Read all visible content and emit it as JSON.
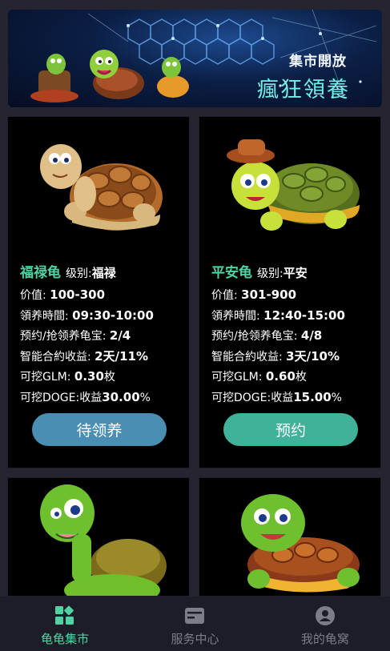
{
  "banner": {
    "line1": "集市開放",
    "line2": "瘋狂領養"
  },
  "cards": [
    {
      "name": "福禄龟",
      "level_label": "级别:",
      "level": "福禄",
      "price_label": "价值:",
      "price": "100-300",
      "time_label": "領养時間:",
      "time": "09:30-10:00",
      "reserve_label": "预约/抢领养龟宝:",
      "reserve": "2/4",
      "yield_label": "智能合約收益:",
      "yield": "2天/11%",
      "glm_label": "可挖GLM:",
      "glm": "0.30",
      "glm_unit": "枚",
      "doge_label": "可挖DOGE:收益",
      "doge": "30.00",
      "doge_unit": "%",
      "button": "待领养",
      "button_color": "#4a8fb3"
    },
    {
      "name": "平安龟",
      "level_label": "级别:",
      "level": "平安",
      "price_label": "价值:",
      "price": "301-900",
      "time_label": "領养時間:",
      "time": "12:40-15:00",
      "reserve_label": "预约/抢领养龟宝:",
      "reserve": "4/8",
      "yield_label": "智能合約收益:",
      "yield": "3天/10%",
      "glm_label": "可挖GLM:",
      "glm": "0.60",
      "glm_unit": "枚",
      "doge_label": "可挖DOGE:收益",
      "doge": "15.00",
      "doge_unit": "%",
      "button": "预约",
      "button_color": "#41b29a"
    }
  ],
  "tabbar": {
    "active_color": "#4fd3a4",
    "inactive_color": "#7b7d88",
    "items": [
      {
        "label": "龟龟集市",
        "icon": "market-grid-icon",
        "active": true
      },
      {
        "label": "服务中心",
        "icon": "service-card-icon",
        "active": false
      },
      {
        "label": "我的龟窝",
        "icon": "user-profile-icon",
        "active": false
      }
    ]
  }
}
